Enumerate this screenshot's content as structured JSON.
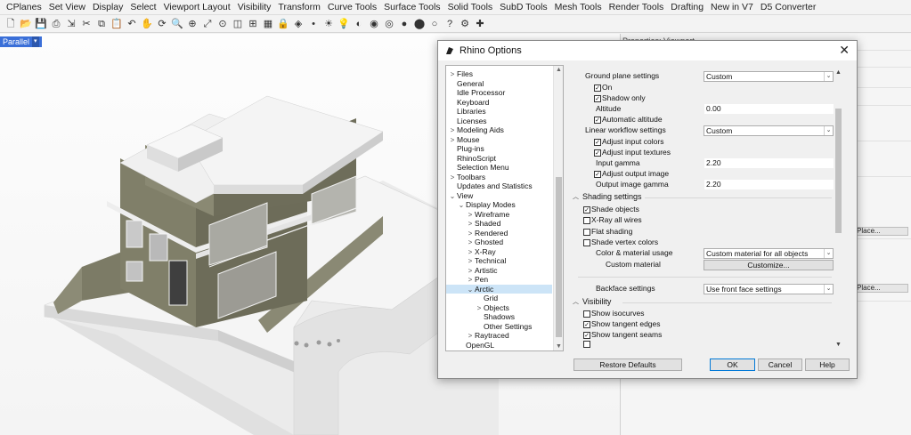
{
  "menu": [
    "CPlanes",
    "Set View",
    "Display",
    "Select",
    "Viewport Layout",
    "Visibility",
    "Transform",
    "Curve Tools",
    "Surface Tools",
    "Solid Tools",
    "SubD Tools",
    "Mesh Tools",
    "Render Tools",
    "Drafting",
    "New in V7",
    "D5 Converter"
  ],
  "toolbar_icons": [
    "new-file-icon",
    "open-icon",
    "save-icon",
    "print-icon",
    "import-icon",
    "cut-icon",
    "copy-icon",
    "paste-icon",
    "undo-icon",
    "pan-icon",
    "rotate-icon",
    "zoom-icon",
    "zoom-window-icon",
    "zoom-extents-icon",
    "zoom-selected-icon",
    "perspective-icon",
    "four-views-icon",
    "grid-icon",
    "lock-icon",
    "layer-icon",
    "point-icon",
    "light-icon",
    "lamp-icon",
    "material-icon",
    "render-sphere-icon",
    "wireframe-sphere-icon",
    "shaded-sphere-icon",
    "rendered-sphere-icon",
    "ghosted-sphere-icon",
    "help-icon",
    "options-icon",
    "plugin-icon"
  ],
  "viewport": {
    "title": "Parallel",
    "dropdown": "▾"
  },
  "right_panel": {
    "title": "Properties: Viewport",
    "button1": "Place...",
    "button2": "Place..."
  },
  "dialog": {
    "title": "Rhino Options",
    "close": "✕",
    "tree": [
      {
        "label": "Files",
        "depth": 0,
        "arrow": ">"
      },
      {
        "label": "General",
        "depth": 0,
        "arrow": ""
      },
      {
        "label": "Idle Processor",
        "depth": 0,
        "arrow": ""
      },
      {
        "label": "Keyboard",
        "depth": 0,
        "arrow": ""
      },
      {
        "label": "Libraries",
        "depth": 0,
        "arrow": ""
      },
      {
        "label": "Licenses",
        "depth": 0,
        "arrow": ""
      },
      {
        "label": "Modeling Aids",
        "depth": 0,
        "arrow": ">"
      },
      {
        "label": "Mouse",
        "depth": 0,
        "arrow": ">"
      },
      {
        "label": "Plug-ins",
        "depth": 0,
        "arrow": ""
      },
      {
        "label": "RhinoScript",
        "depth": 0,
        "arrow": ""
      },
      {
        "label": "Selection Menu",
        "depth": 0,
        "arrow": ""
      },
      {
        "label": "Toolbars",
        "depth": 0,
        "arrow": ">"
      },
      {
        "label": "Updates and Statistics",
        "depth": 0,
        "arrow": ""
      },
      {
        "label": "View",
        "depth": 0,
        "arrow": "⌄"
      },
      {
        "label": "Display Modes",
        "depth": 1,
        "arrow": "⌄"
      },
      {
        "label": "Wireframe",
        "depth": 2,
        "arrow": ">"
      },
      {
        "label": "Shaded",
        "depth": 2,
        "arrow": ">"
      },
      {
        "label": "Rendered",
        "depth": 2,
        "arrow": ">"
      },
      {
        "label": "Ghosted",
        "depth": 2,
        "arrow": ">"
      },
      {
        "label": "X-Ray",
        "depth": 2,
        "arrow": ">"
      },
      {
        "label": "Technical",
        "depth": 2,
        "arrow": ">"
      },
      {
        "label": "Artistic",
        "depth": 2,
        "arrow": ">"
      },
      {
        "label": "Pen",
        "depth": 2,
        "arrow": ">"
      },
      {
        "label": "Arctic",
        "depth": 2,
        "arrow": "⌄",
        "selected": true
      },
      {
        "label": "Grid",
        "depth": 3,
        "arrow": ""
      },
      {
        "label": "Objects",
        "depth": 3,
        "arrow": ">"
      },
      {
        "label": "Shadows",
        "depth": 3,
        "arrow": ""
      },
      {
        "label": "Other Settings",
        "depth": 3,
        "arrow": ""
      },
      {
        "label": "Raytraced",
        "depth": 2,
        "arrow": ">"
      },
      {
        "label": "OpenGL",
        "depth": 1,
        "arrow": ""
      }
    ],
    "settings": {
      "ground_plane_label": "Ground plane settings",
      "ground_plane_value": "Custom",
      "on_label": "On",
      "shadow_only_label": "Shadow only",
      "altitude_label": "Altitude",
      "altitude_value": "0.00",
      "auto_altitude_label": "Automatic altitude",
      "linear_workflow_label": "Linear workflow settings",
      "linear_workflow_value": "Custom",
      "adjust_input_colors_label": "Adjust input colors",
      "adjust_input_textures_label": "Adjust input textures",
      "input_gamma_label": "Input gamma",
      "input_gamma_value": "2.20",
      "adjust_output_image_label": "Adjust output image",
      "output_gamma_label": "Output image gamma",
      "output_gamma_value": "2.20",
      "shading_section": "Shading settings",
      "shade_objects_label": "Shade objects",
      "xray_label": "X-Ray all wires",
      "flat_shading_label": "Flat shading",
      "shade_vertex_label": "Shade vertex colors",
      "color_material_label": "Color & material usage",
      "color_material_value": "Custom material for all objects",
      "custom_material_label": "Custom material",
      "customize_button": "Customize...",
      "backface_label": "Backface settings",
      "backface_value": "Use front face settings",
      "visibility_section": "Visibility",
      "show_isocurves_label": "Show isocurves",
      "show_tangent_edges_label": "Show tangent edges",
      "show_tangent_seams_label": "Show tangent seams"
    },
    "checks": {
      "on": true,
      "shadow_only": true,
      "auto_altitude": true,
      "adjust_input_colors": true,
      "adjust_input_textures": true,
      "adjust_output_image": true,
      "shade_objects": true,
      "xray": false,
      "flat_shading": false,
      "shade_vertex": false,
      "show_isocurves": false,
      "show_tangent_edges": true,
      "show_tangent_seams": true
    },
    "buttons": {
      "restore": "Restore Defaults",
      "ok": "OK",
      "cancel": "Cancel",
      "help": "Help"
    }
  },
  "colors": {
    "wall": "#7c7b66",
    "slab": "#f2f2f2",
    "selection": "#cce4f7",
    "accent": "#0078d7"
  }
}
